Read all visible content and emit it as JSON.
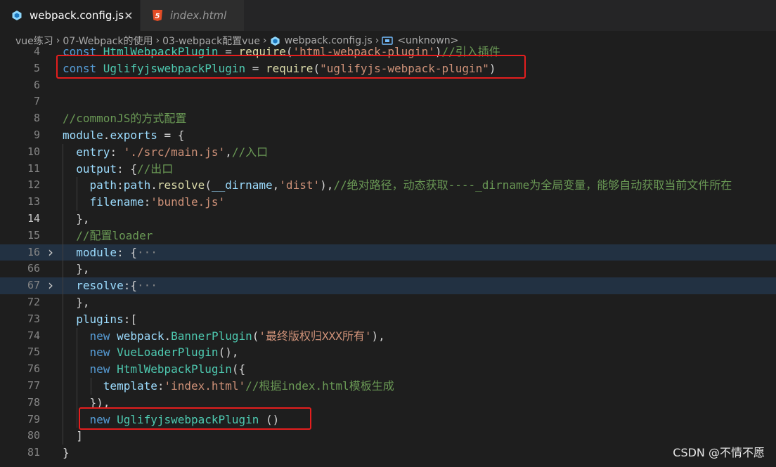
{
  "tabs": [
    {
      "label": "webpack.config.js",
      "active": true,
      "close": "✕"
    },
    {
      "label": "index.html",
      "active": false
    }
  ],
  "breadcrumb": [
    "vue练习",
    "07-Webpack的使用",
    "03-webpack配置vue",
    "webpack.config.js",
    "<unknown>"
  ],
  "colors": {
    "highlight_box": "#e51e1e",
    "accent": "#569cd6"
  },
  "icons": {
    "webpack_tab": "webpack-cube-icon",
    "html_tab": "html5-icon",
    "symbol": "symbol-variable-icon"
  },
  "lines": [
    {
      "num": "4",
      "tokens": [
        [
          "kw",
          "const "
        ],
        [
          "cls",
          "HtmlWebpackPlugin"
        ],
        [
          "pun",
          " = "
        ],
        [
          "fn",
          "require"
        ],
        [
          "pun",
          "("
        ],
        [
          "str",
          "'html-webpack-plugin'"
        ],
        [
          "pun",
          ")"
        ],
        [
          "com",
          "//引入插件"
        ]
      ]
    },
    {
      "num": "5",
      "tokens": [
        [
          "kw",
          "const "
        ],
        [
          "cls",
          "UglifyjswebpackPlugin"
        ],
        [
          "pun",
          " = "
        ],
        [
          "fn",
          "require"
        ],
        [
          "pun",
          "("
        ],
        [
          "str",
          "\"uglifyjs-webpack-plugin\""
        ],
        [
          "pun",
          ")"
        ]
      ]
    },
    {
      "num": "6",
      "tokens": []
    },
    {
      "num": "7",
      "tokens": []
    },
    {
      "num": "8",
      "tokens": [
        [
          "com",
          "//commonJS的方式配置"
        ]
      ]
    },
    {
      "num": "9",
      "tokens": [
        [
          "var",
          "module"
        ],
        [
          "pun",
          "."
        ],
        [
          "var",
          "exports"
        ],
        [
          "pun",
          " = {"
        ]
      ]
    },
    {
      "num": "10",
      "tokens": [
        [
          "pun",
          "  "
        ],
        [
          "var",
          "entry"
        ],
        [
          "pun",
          ": "
        ],
        [
          "str",
          "'./src/main.js'"
        ],
        [
          "pun",
          ","
        ],
        [
          "com",
          "//入口"
        ]
      ]
    },
    {
      "num": "11",
      "tokens": [
        [
          "pun",
          "  "
        ],
        [
          "var",
          "output"
        ],
        [
          "pun",
          ": {"
        ],
        [
          "com",
          "//出口"
        ]
      ]
    },
    {
      "num": "12",
      "tokens": [
        [
          "pun",
          "    "
        ],
        [
          "var",
          "path"
        ],
        [
          "pun",
          ":"
        ],
        [
          "var",
          "path"
        ],
        [
          "pun",
          "."
        ],
        [
          "fn",
          "resolve"
        ],
        [
          "pun",
          "("
        ],
        [
          "var",
          "__dirname"
        ],
        [
          "pun",
          ","
        ],
        [
          "str",
          "'dist'"
        ],
        [
          "pun",
          "),"
        ],
        [
          "com",
          "//绝对路径，动态获取----_dirname为全局变量，能够自动获取当前文件所在"
        ]
      ]
    },
    {
      "num": "13",
      "tokens": [
        [
          "pun",
          "    "
        ],
        [
          "var",
          "filename"
        ],
        [
          "pun",
          ":"
        ],
        [
          "str",
          "'bundle.js'"
        ]
      ]
    },
    {
      "num": "14",
      "current": true,
      "tokens": [
        [
          "pun",
          "  },"
        ]
      ]
    },
    {
      "num": "15",
      "tokens": [
        [
          "pun",
          "  "
        ],
        [
          "com",
          "//配置loader"
        ]
      ]
    },
    {
      "num": "16",
      "folded": true,
      "tokens": [
        [
          "pun",
          "  "
        ],
        [
          "var",
          "module"
        ],
        [
          "pun",
          ": {"
        ],
        [
          "dots",
          "···"
        ]
      ]
    },
    {
      "num": "66",
      "tokens": [
        [
          "pun",
          "  },"
        ]
      ]
    },
    {
      "num": "67",
      "folded": true,
      "tokens": [
        [
          "pun",
          "  "
        ],
        [
          "var",
          "resolve"
        ],
        [
          "pun",
          ":{"
        ],
        [
          "dots",
          "···"
        ]
      ]
    },
    {
      "num": "72",
      "tokens": [
        [
          "pun",
          "  },"
        ]
      ]
    },
    {
      "num": "73",
      "tokens": [
        [
          "pun",
          "  "
        ],
        [
          "var",
          "plugins"
        ],
        [
          "pun",
          ":["
        ]
      ]
    },
    {
      "num": "74",
      "tokens": [
        [
          "pun",
          "    "
        ],
        [
          "kw",
          "new "
        ],
        [
          "var",
          "webpack"
        ],
        [
          "pun",
          "."
        ],
        [
          "cls",
          "BannerPlugin"
        ],
        [
          "pun",
          "("
        ],
        [
          "str",
          "'最终版权归XXX所有'"
        ],
        [
          "pun",
          "),"
        ]
      ]
    },
    {
      "num": "75",
      "tokens": [
        [
          "pun",
          "    "
        ],
        [
          "kw",
          "new "
        ],
        [
          "cls",
          "VueLoaderPlugin"
        ],
        [
          "pun",
          "(),"
        ]
      ]
    },
    {
      "num": "76",
      "tokens": [
        [
          "pun",
          "    "
        ],
        [
          "kw",
          "new "
        ],
        [
          "cls",
          "HtmlWebpackPlugin"
        ],
        [
          "pun",
          "({"
        ]
      ]
    },
    {
      "num": "77",
      "tokens": [
        [
          "pun",
          "      "
        ],
        [
          "var",
          "template"
        ],
        [
          "pun",
          ":"
        ],
        [
          "str",
          "'index.html'"
        ],
        [
          "com",
          "//根据index.html模板生成"
        ]
      ]
    },
    {
      "num": "78",
      "tokens": [
        [
          "pun",
          "    }),"
        ]
      ]
    },
    {
      "num": "79",
      "tokens": [
        [
          "pun",
          "    "
        ],
        [
          "kw",
          "new "
        ],
        [
          "cls",
          "UglifyjswebpackPlugin"
        ],
        [
          "pun",
          " ()"
        ]
      ]
    },
    {
      "num": "80",
      "tokens": [
        [
          "pun",
          "  ]"
        ]
      ]
    },
    {
      "num": "81",
      "tokens": [
        [
          "pun",
          "}"
        ]
      ]
    }
  ],
  "watermark": "CSDN @不情不愿"
}
